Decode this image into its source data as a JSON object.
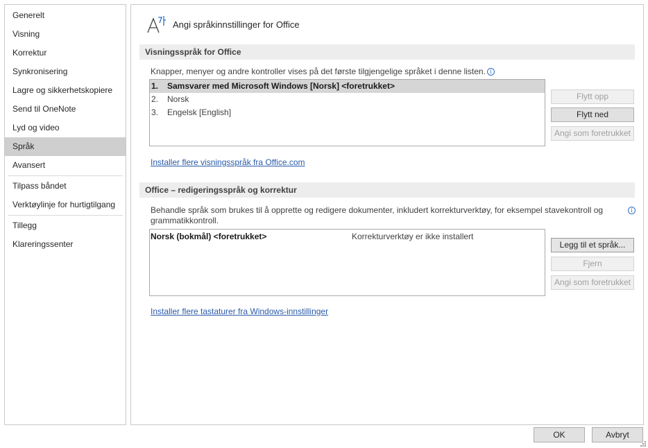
{
  "sidebar": {
    "items": [
      {
        "label": "Generelt"
      },
      {
        "label": "Visning"
      },
      {
        "label": "Korrektur"
      },
      {
        "label": "Synkronisering"
      },
      {
        "label": "Lagre og sikkerhetskopiere"
      },
      {
        "label": "Send til OneNote"
      },
      {
        "label": "Lyd og video"
      },
      {
        "label": "Språk"
      },
      {
        "label": "Avansert"
      },
      {
        "label": "Tilpass båndet"
      },
      {
        "label": "Verktøylinje for hurtigtilgang"
      },
      {
        "label": "Tillegg"
      },
      {
        "label": "Klareringssenter"
      }
    ],
    "selected": "Språk"
  },
  "main": {
    "title": "Angi språkinnstillinger for Office",
    "title_icon": "language-settings-icon",
    "display": {
      "header": "Visningsspråk for Office",
      "description": "Knapper, menyer og andre kontroller vises på det første tilgjengelige språket i denne listen.",
      "languages": [
        {
          "num": "1.",
          "label": "Samsvarer med Microsoft Windows [Norsk] <foretrukket>"
        },
        {
          "num": "2.",
          "label": "Norsk"
        },
        {
          "num": "3.",
          "label": "Engelsk [English]"
        }
      ],
      "buttons": {
        "move_up": "Flytt opp",
        "move_down": "Flytt ned",
        "set_preferred": "Angi som foretrukket"
      },
      "link": "Installer flere visningsspråk fra Office.com"
    },
    "editing": {
      "header": "Office – redigeringsspråk og korrektur",
      "description_line1": "Behandle språk som brukes til å opprette og redigere dokumenter, inkludert korrekturverktøy, for eksempel stavekontroll og",
      "description_line2": "grammatikkontroll.",
      "languages": [
        {
          "label": "Norsk (bokmål) <foretrukket>",
          "status": "Korrekturverktøy er ikke installert"
        }
      ],
      "buttons": {
        "add": "Legg til et språk...",
        "remove": "Fjern",
        "set_preferred": "Angi som foretrukket"
      },
      "link": "Installer flere tastaturer fra Windows-innstillinger"
    }
  },
  "footer": {
    "ok": "OK",
    "cancel": "Avbryt"
  },
  "colors": {
    "selected_bg": "#cfcfcf",
    "section_header_bg": "#ededed",
    "link": "#2a5aa8",
    "info_icon": "#2f6fbf"
  }
}
